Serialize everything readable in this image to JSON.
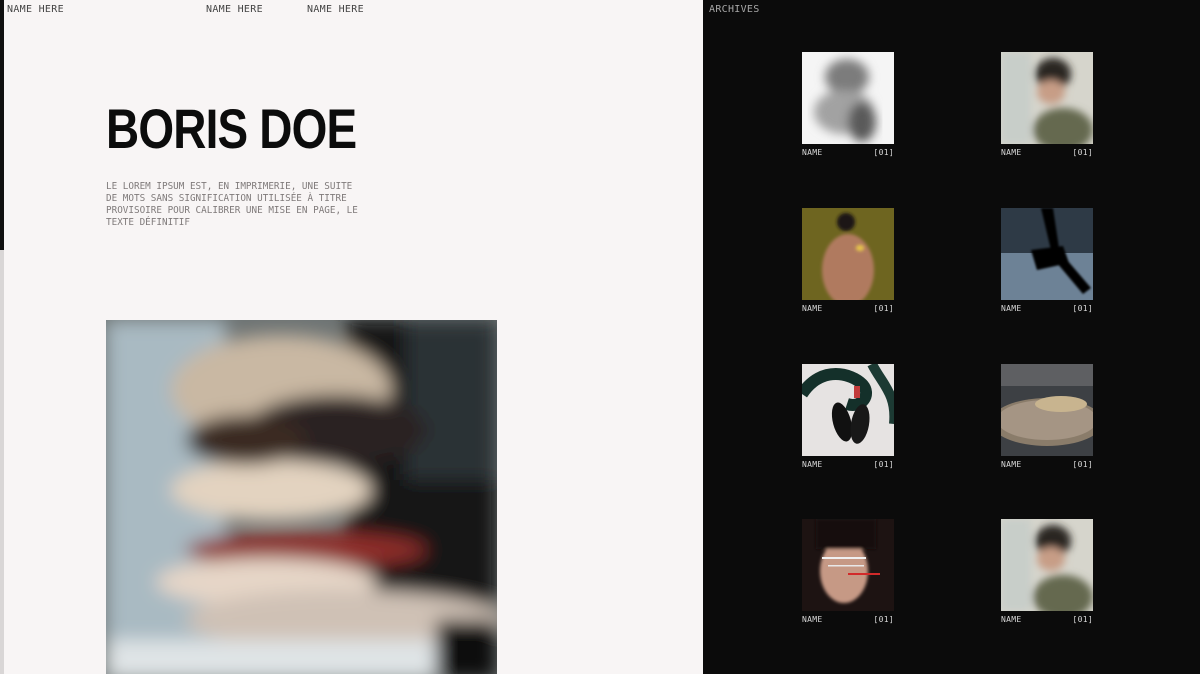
{
  "nav": {
    "items": [
      {
        "label": "NAME HERE"
      },
      {
        "label": "NAME HERE"
      },
      {
        "label": "NAME HERE"
      }
    ]
  },
  "hero": {
    "title": "BORIS DOE",
    "description": "LE LOREM IPSUM EST, EN IMPRIMERIE, UNE SUITE DE MOTS SANS SIGNIFICATION UTILISÉE À TITRE PROVISOIRE POUR CALIBRER UNE MISE EN PAGE, LE TEXTE DÉFINITIF",
    "image": "blurred-portrait-photo"
  },
  "archives": {
    "title": "ARCHIVES",
    "items": [
      {
        "name": "NAME",
        "index": "[01]",
        "image": "grainy-grayscale-figure"
      },
      {
        "name": "NAME",
        "index": "[01]",
        "image": "blurred-portrait-green-jacket"
      },
      {
        "name": "NAME",
        "index": "[01]",
        "image": "bare-back-on-olive"
      },
      {
        "name": "NAME",
        "index": "[01]",
        "image": "black-sunglasses-on-blue"
      },
      {
        "name": "NAME",
        "index": "[01]",
        "image": "snake-and-loafers"
      },
      {
        "name": "NAME",
        "index": "[01]",
        "image": "sunlit-concrete-slab"
      },
      {
        "name": "NAME",
        "index": "[01]",
        "image": "glitched-portrait-bangs"
      },
      {
        "name": "NAME",
        "index": "[01]",
        "image": "blurred-portrait-green-jacket"
      }
    ]
  },
  "colors": {
    "left_background": "#f8f5f5",
    "right_background": "#0b0b0b",
    "title_text": "#0c0c0c",
    "muted_text": "#7f7a7a"
  }
}
